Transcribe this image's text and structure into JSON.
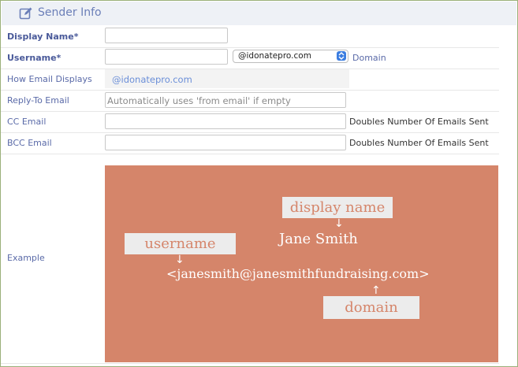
{
  "header": {
    "title": "Sender Info",
    "icon": "edit-icon"
  },
  "rows": {
    "display_name": {
      "label": "Display Name*",
      "value": ""
    },
    "username": {
      "label": "Username*",
      "value": "",
      "domain_select": "@idonatepro.com",
      "domain_link": "Domain"
    },
    "how_email_displays": {
      "label": "How Email Displays",
      "value": "@idonatepro.com"
    },
    "reply_to": {
      "label": "Reply-To Email",
      "placeholder": "Automatically uses 'from email' if empty"
    },
    "cc": {
      "label": "CC Email",
      "value": "",
      "note": "Doubles Number Of Emails Sent"
    },
    "bcc": {
      "label": "BCC Email",
      "value": "",
      "note": "Doubles Number Of Emails Sent"
    },
    "example": {
      "label": "Example"
    }
  },
  "example_graphic": {
    "display_name_tag": "display name",
    "username_tag": "username",
    "domain_tag": "domain",
    "name": "Jane Smith",
    "address": "<janesmith@janesmithfundraising.com>",
    "background_color": "#d5856a",
    "tag_color": "#ececec"
  }
}
